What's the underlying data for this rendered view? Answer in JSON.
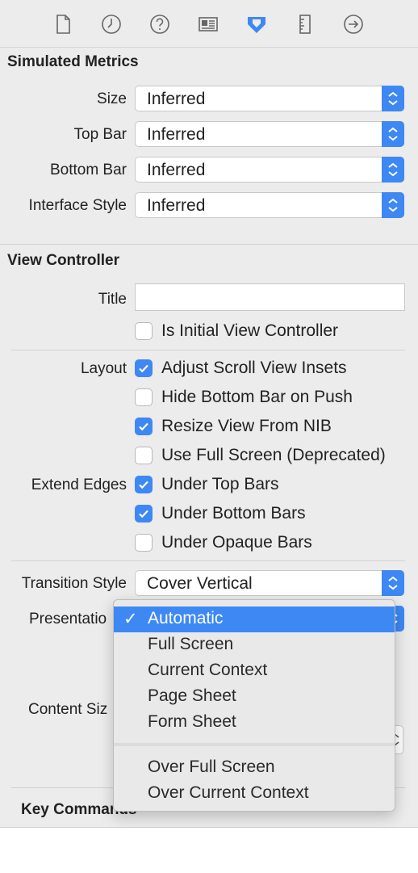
{
  "toolbar": {
    "icons": [
      "file-icon",
      "clock-icon",
      "help-icon",
      "identity-card-icon",
      "attributes-icon",
      "ruler-icon",
      "arrow-right-circle-icon"
    ],
    "accent": "#3e88f4"
  },
  "simulated_metrics": {
    "title": "Simulated Metrics",
    "size": {
      "label": "Size",
      "value": "Inferred"
    },
    "top_bar": {
      "label": "Top Bar",
      "value": "Inferred"
    },
    "bottom_bar": {
      "label": "Bottom Bar",
      "value": "Inferred"
    },
    "interface_style": {
      "label": "Interface Style",
      "value": "Inferred"
    }
  },
  "view_controller": {
    "title": "View Controller",
    "title_label": "Title",
    "title_value": "",
    "is_initial": {
      "label": "Is Initial View Controller",
      "checked": false
    },
    "layout_label": "Layout",
    "adjust_scroll": {
      "label": "Adjust Scroll View Insets",
      "checked": true
    },
    "hide_bottom": {
      "label": "Hide Bottom Bar on Push",
      "checked": false
    },
    "resize_nib": {
      "label": "Resize View From NIB",
      "checked": true
    },
    "full_screen": {
      "label": "Use Full Screen (Deprecated)",
      "checked": false
    },
    "extend_edges_label": "Extend Edges",
    "under_top": {
      "label": "Under Top Bars",
      "checked": true
    },
    "under_bottom": {
      "label": "Under Bottom Bars",
      "checked": true
    },
    "under_opaque": {
      "label": "Under Opaque Bars",
      "checked": false
    },
    "transition_style": {
      "label": "Transition Style",
      "value": "Cover Vertical"
    },
    "presentation_label": "Presentatio",
    "content_size_label": "Content Siz"
  },
  "presentation_menu": {
    "check": "✓",
    "items": [
      "Automatic",
      "Full Screen",
      "Current Context",
      "Page Sheet",
      "Form Sheet",
      "Over Full Screen",
      "Over Current Context"
    ],
    "selected": "Automatic"
  },
  "key_commands": {
    "title": "Key Commands"
  }
}
